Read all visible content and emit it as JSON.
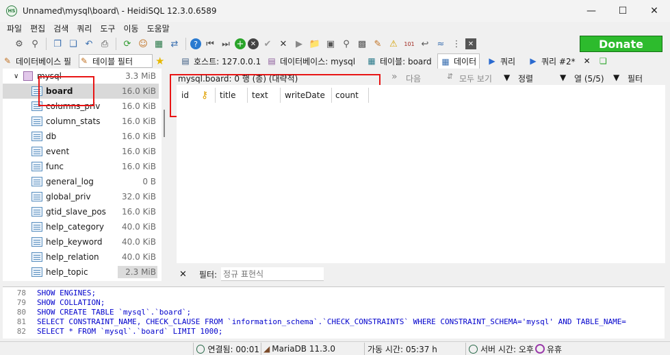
{
  "window": {
    "title": "Unnamed\\mysql\\board\\ - HeidiSQL 12.3.0.6589",
    "app_icon_text": "HS"
  },
  "menu": [
    "파일",
    "편집",
    "검색",
    "쿼리",
    "도구",
    "이동",
    "도움말"
  ],
  "donate_label": "Donate",
  "side_tabs": {
    "db_filter": "데이터베이스 필",
    "table_filter": "테이블 필터"
  },
  "tabs": [
    {
      "label": "호스트: 127.0.0.1"
    },
    {
      "label": "데이터베이스: mysql"
    },
    {
      "label": "테이블: board"
    },
    {
      "label": "데이터"
    },
    {
      "label": "쿼리"
    },
    {
      "label": "쿼리 #2*"
    }
  ],
  "tree": {
    "db": {
      "name": "mysql",
      "size": "3.3 MiB"
    },
    "tables": [
      {
        "name": "board",
        "size": "16.0 KiB"
      },
      {
        "name": "columns_priv",
        "size": "16.0 KiB"
      },
      {
        "name": "column_stats",
        "size": "16.0 KiB"
      },
      {
        "name": "db",
        "size": "16.0 KiB"
      },
      {
        "name": "event",
        "size": "16.0 KiB"
      },
      {
        "name": "func",
        "size": "16.0 KiB"
      },
      {
        "name": "general_log",
        "size": "0 B"
      },
      {
        "name": "global_priv",
        "size": "32.0 KiB"
      },
      {
        "name": "gtid_slave_pos",
        "size": "16.0 KiB"
      },
      {
        "name": "help_category",
        "size": "40.0 KiB"
      },
      {
        "name": "help_keyword",
        "size": "40.0 KiB"
      },
      {
        "name": "help_relation",
        "size": "40.0 KiB"
      },
      {
        "name": "help_topic",
        "size": "2.3 MiB"
      }
    ]
  },
  "data_toolbar": {
    "info": "mysql.board: 0 행 (총) (대략적)",
    "next": "다음",
    "show_all": "모두 보기",
    "sort": "정렬",
    "columns": "열 (5/5)",
    "filter": "필터"
  },
  "grid_columns": [
    "id",
    "title",
    "text",
    "writeDate",
    "count"
  ],
  "filter_bar": {
    "label": "필터:",
    "placeholder": "정규 표현식"
  },
  "sql_log": [
    {
      "num": "78",
      "text": "SHOW ENGINES;"
    },
    {
      "num": "79",
      "text": "SHOW COLLATION;"
    },
    {
      "num": "80",
      "text": "SHOW CREATE TABLE `mysql`.`board`;"
    },
    {
      "num": "81",
      "text": "SELECT CONSTRAINT_NAME, CHECK_CLAUSE FROM `information_schema`.`CHECK_CONSTRAINTS` WHERE CONSTRAINT_SCHEMA='mysql' AND TABLE_NAME="
    },
    {
      "num": "82",
      "text": "SELECT * FROM `mysql`.`board` LIMIT 1000;"
    }
  ],
  "status": {
    "connected": "연결됨: 00:01",
    "server": "MariaDB 11.3.0",
    "uptime": "가동 시간: 05:37 h",
    "server_time": "서버 시간: 오후",
    "idle": "유휴"
  },
  "colors": {
    "donate": "#2dbb2d",
    "highlight": "#e81414",
    "keyword": "#0000cc"
  }
}
